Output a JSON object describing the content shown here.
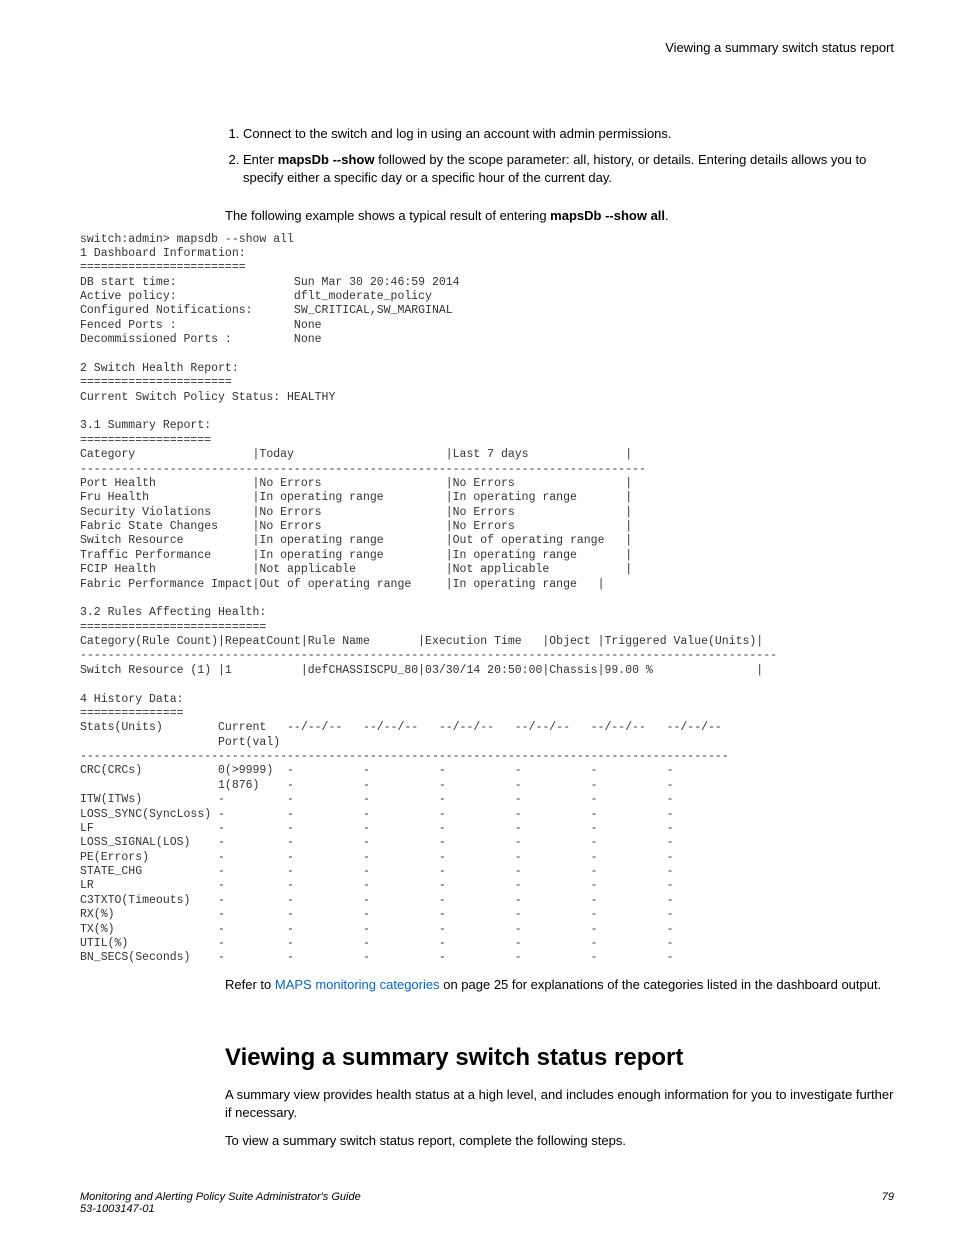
{
  "header": {
    "title": "Viewing a summary switch status report"
  },
  "steps": {
    "s1": "Connect to the switch and log in using an account with admin permissions.",
    "s2a": "Enter ",
    "s2_cmd": "mapsDb --show",
    "s2b": " followed by the scope parameter: all, history, or details. Entering details allows you to specify either a specific day or a specific hour of the current day."
  },
  "intro": {
    "a": "The following example shows a typical result of entering ",
    "b": "mapsDb --show all",
    "c": "."
  },
  "console": "switch:admin> mapsdb --show all\n1 Dashboard Information:\n========================\nDB start time:                 Sun Mar 30 20:46:59 2014\nActive policy:                 dflt_moderate_policy\nConfigured Notifications:      SW_CRITICAL,SW_MARGINAL\nFenced Ports :                 None\nDecommissioned Ports :         None\n\n2 Switch Health Report:\n======================\nCurrent Switch Policy Status: HEALTHY\n\n3.1 Summary Report:\n===================\nCategory                 |Today                      |Last 7 days              |\n----------------------------------------------------------------------------------\nPort Health              |No Errors                  |No Errors                |\nFru Health               |In operating range         |In operating range       |\nSecurity Violations      |No Errors                  |No Errors                |\nFabric State Changes     |No Errors                  |No Errors                |\nSwitch Resource          |In operating range         |Out of operating range   |\nTraffic Performance      |In operating range         |In operating range       |\nFCIP Health              |Not applicable             |Not applicable           |\nFabric Performance Impact|Out of operating range     |In operating range   |\n\n3.2 Rules Affecting Health:\n===========================\nCategory(Rule Count)|RepeatCount|Rule Name       |Execution Time   |Object |Triggered Value(Units)|\n-----------------------------------------------------------------------------------------------------\nSwitch Resource (1) |1          |defCHASSISCPU_80|03/30/14 20:50:00|Chassis|99.00 %               |\n\n4 History Data:\n===============\nStats(Units)        Current   --/--/--   --/--/--   --/--/--   --/--/--   --/--/--   --/--/--\n                    Port(val)\n----------------------------------------------------------------------------------------------\nCRC(CRCs)           0(>9999)  -          -          -          -          -          -\n                    1(876)    -          -          -          -          -          -\nITW(ITWs)           -         -          -          -          -          -          -\nLOSS_SYNC(SyncLoss) -         -          -          -          -          -          -\nLF                  -         -          -          -          -          -          -\nLOSS_SIGNAL(LOS)    -         -          -          -          -          -          -\nPE(Errors)          -         -          -          -          -          -          -\nSTATE_CHG           -         -          -          -          -          -          -\nLR                  -         -          -          -          -          -          -\nC3TXTO(Timeouts)    -         -          -          -          -          -          -\nRX(%)               -         -          -          -          -          -          -\nTX(%)               -         -          -          -          -          -          -\nUTIL(%)             -         -          -          -          -          -          -\nBN_SECS(Seconds)    -         -          -          -          -          -          -",
  "refer": {
    "a": "Refer to ",
    "link": "MAPS monitoring categories",
    "b": " on page 25 for explanations of the categories listed in the dashboard output."
  },
  "section2": {
    "heading": "Viewing a summary switch status report",
    "p1": "A summary view provides health status at a high level, and includes enough information for you to investigate further if necessary.",
    "p2": "To view a summary switch status report, complete the following steps."
  },
  "footer": {
    "title": "Monitoring and Alerting Policy Suite Administrator's Guide",
    "docnum": "53-1003147-01",
    "page": "79"
  }
}
